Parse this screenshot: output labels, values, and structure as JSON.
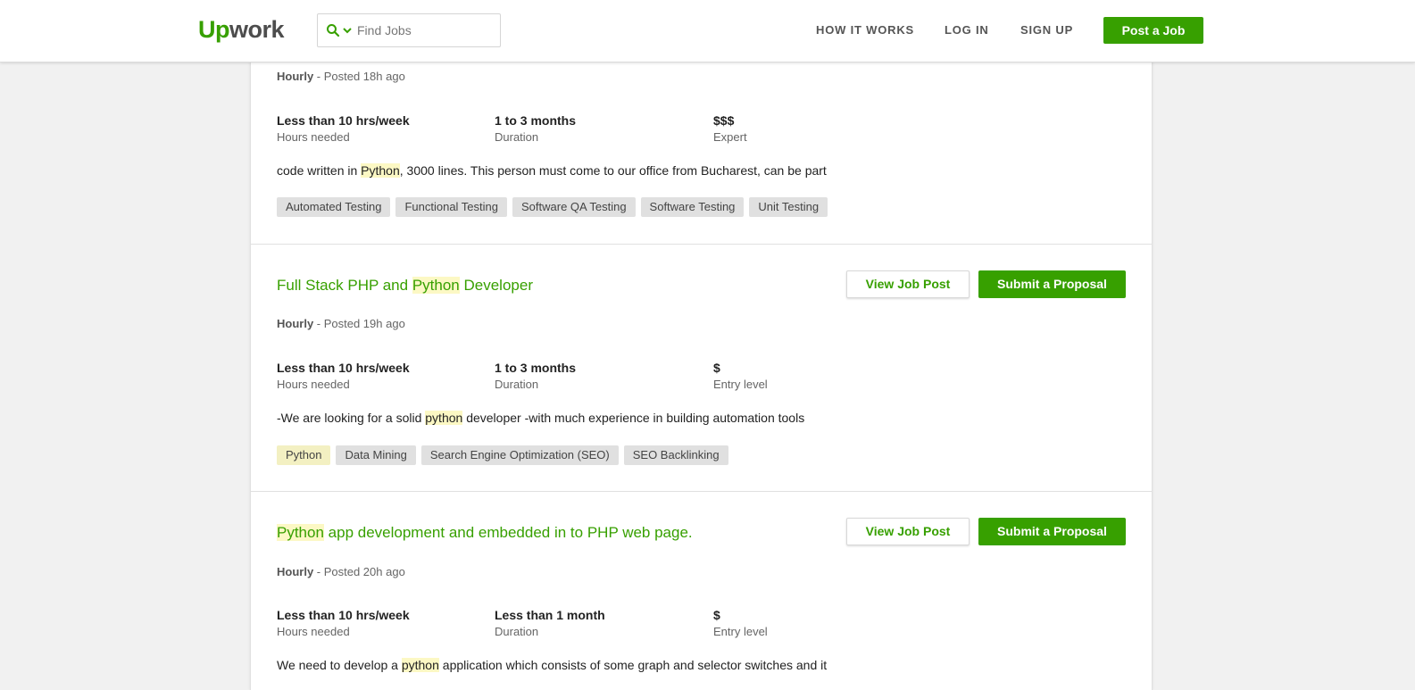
{
  "header": {
    "logo_up": "Up",
    "logo_work": "work",
    "search_placeholder": "Find Jobs",
    "nav": [
      "HOW IT WORKS",
      "LOG IN",
      "SIGN UP"
    ],
    "post_job": "Post a Job",
    "accent_color": "#37a000"
  },
  "jobs": [
    {
      "title_parts": [],
      "type": "Hourly",
      "posted": " - Posted 18h ago",
      "hours": "Less than 10 hrs/week",
      "hours_label": "Hours needed",
      "duration": "1 to 3 months",
      "duration_label": "Duration",
      "level": "$$$",
      "level_label": "Expert",
      "desc_before": "code written in ",
      "desc_hl": "Python",
      "desc_after": ", 3000 lines. This person must come to our office from Bucharest, can be part",
      "skills": [
        "Automated Testing",
        "Functional Testing",
        "Software QA Testing",
        "Software Testing",
        "Unit Testing"
      ]
    },
    {
      "title_before": "Full Stack PHP and ",
      "title_hl": "Python",
      "title_after": " Developer",
      "view_label": "View Job Post",
      "submit_label": "Submit a Proposal",
      "type": "Hourly",
      "posted": " - Posted 19h ago",
      "hours": "Less than 10 hrs/week",
      "hours_label": "Hours needed",
      "duration": "1 to 3 months",
      "duration_label": "Duration",
      "level": "$",
      "level_label": "Entry level",
      "desc_before": "-We are looking for a solid ",
      "desc_hl": "python",
      "desc_after": " developer -with much experience in building automation tools",
      "skills": [
        "Python",
        "Data Mining",
        "Search Engine Optimization (SEO)",
        "SEO Backlinking"
      ]
    },
    {
      "title_before": "",
      "title_hl": "Python",
      "title_after": " app development and embedded in to PHP web page.",
      "view_label": "View Job Post",
      "submit_label": "Submit a Proposal",
      "type": "Hourly",
      "posted": " - Posted 20h ago",
      "hours": "Less than 10 hrs/week",
      "hours_label": "Hours needed",
      "duration": "Less than 1 month",
      "duration_label": "Duration",
      "level": "$",
      "level_label": "Entry level",
      "desc_before": "We need to develop a ",
      "desc_hl": "python",
      "desc_after": " application which consists of some graph and selector switches and it"
    }
  ]
}
